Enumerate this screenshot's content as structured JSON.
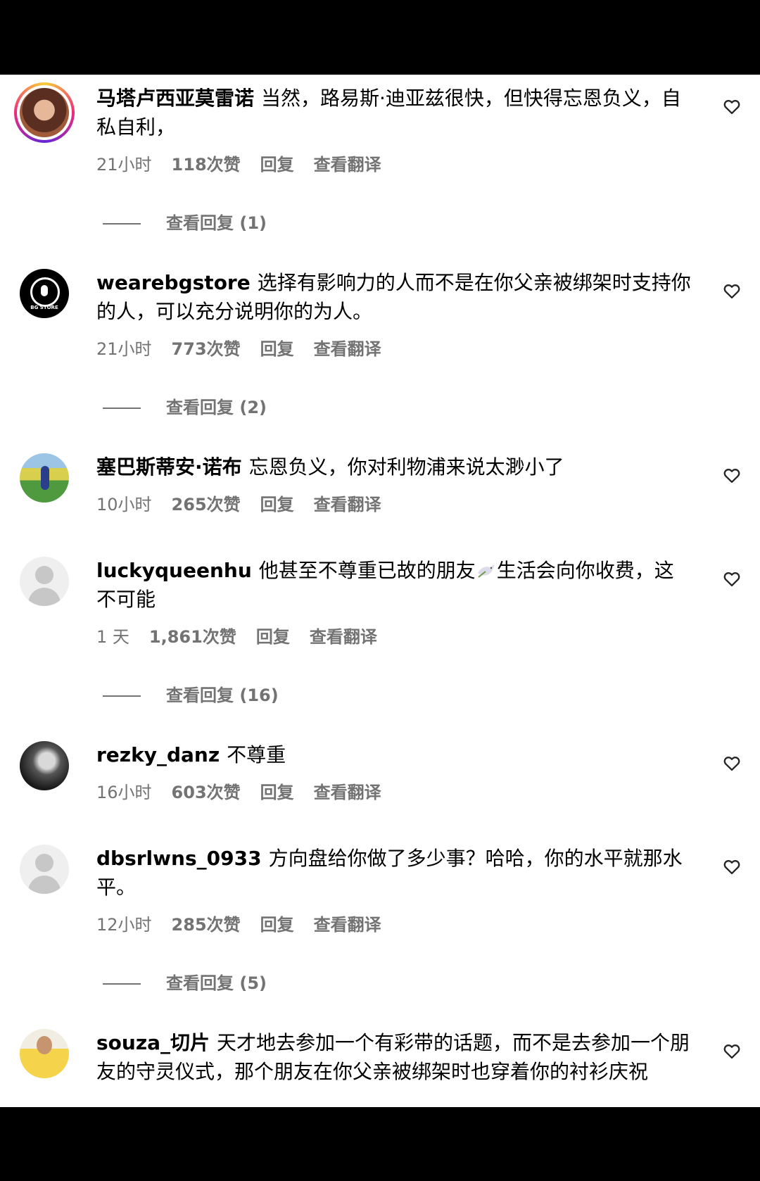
{
  "comments": [
    {
      "username": "马塔卢西亚莫雷诺",
      "text": "当然，路易斯·迪亚兹很快，但快得忘恩负义，自私自利，",
      "time": "21小时",
      "likes": "118次赞",
      "reply_label": "回复",
      "translate_label": "查看翻译",
      "view_replies": "查看回复 (1)",
      "avatar": "woman-portrait-story-ring"
    },
    {
      "username": "wearebgstore",
      "text": "选择有影响力的人而不是在你父亲被绑架时支持你的人，可以充分说明你的为人。",
      "time": "21小时",
      "likes": "773次赞",
      "reply_label": "回复",
      "translate_label": "查看翻译",
      "view_replies": "查看回复 (2)",
      "avatar": "bg-store-logo",
      "avatar_text": "BG STORE"
    },
    {
      "username": "塞巴斯蒂安·诺布",
      "text": "忘恩负义，你对利物浦来说太渺小了",
      "time": "10小时",
      "likes": "265次赞",
      "reply_label": "回复",
      "translate_label": "查看翻译",
      "avatar": "football-field-photo"
    },
    {
      "username": "luckyqueenhu",
      "text_before_emoji": "他甚至不尊重已故的朋友",
      "emoji": "dove-icon",
      "text": "生活会向你收费，这不可能",
      "time": "1 天",
      "likes": "1,861次赞",
      "reply_label": "回复",
      "translate_label": "查看翻译",
      "view_replies": "查看回复 (16)",
      "avatar": "default-user"
    },
    {
      "username": "rezky_danz",
      "text": "不尊重",
      "time": "16小时",
      "likes": "603次赞",
      "reply_label": "回复",
      "translate_label": "查看翻译",
      "avatar": "dark-photo"
    },
    {
      "username": "dbsrlwns_0933",
      "text": "方向盘给你做了多少事？哈哈，你的水平就那水平。",
      "time": "12小时",
      "likes": "285次赞",
      "reply_label": "回复",
      "translate_label": "查看翻译",
      "view_replies": "查看回复 (5)",
      "avatar": "default-user"
    },
    {
      "username": "souza_切片",
      "text": "天才地去参加一个有彩带的话题，而不是去参加一个朋友的守灵仪式，那个朋友在你父亲被绑架时也穿着你的衬衫庆祝",
      "avatar": "person-yellow-shirt"
    }
  ],
  "colors": {
    "secondary_text": "#737373",
    "primary_text": "#000000",
    "letterbox": "#000000"
  }
}
